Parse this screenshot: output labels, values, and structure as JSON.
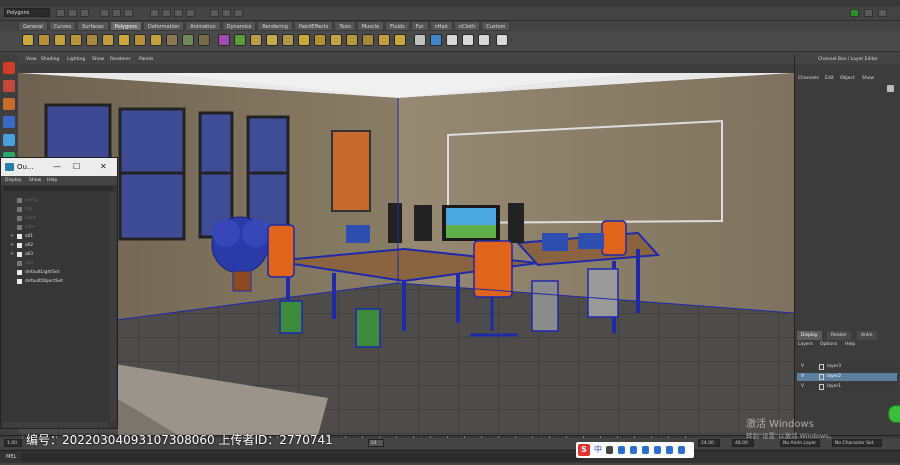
{
  "status_line": {
    "mode": "Polygons"
  },
  "shelf": {
    "tabs": [
      "General",
      "Curves",
      "Surfaces",
      "Polygons",
      "Deformation",
      "Animation",
      "Dynamics",
      "Rendering",
      "PaintEffects",
      "Toon",
      "Muscle",
      "Fluids",
      "Fur",
      "nHair",
      "nCloth",
      "Custom"
    ],
    "active_tab": "Polygons"
  },
  "panel_menu": [
    "View",
    "Shading",
    "Lighting",
    "Show",
    "Renderer",
    "Panels"
  ],
  "channel_box": {
    "title": "Channel Box / Layer Editor",
    "menu": [
      "Channels",
      "Edit",
      "Object",
      "Show"
    ]
  },
  "layer_editor": {
    "tabs": [
      "Display",
      "Render",
      "Anim"
    ],
    "active_tab": "Display",
    "menu": [
      "Layers",
      "Options",
      "Help"
    ],
    "layers": [
      {
        "visible": "V",
        "name": "layer3",
        "selected": false
      },
      {
        "visible": "V",
        "name": "layer2",
        "selected": true
      },
      {
        "visible": "V",
        "name": "layer1",
        "selected": false
      }
    ]
  },
  "outliner": {
    "title": "Ou...",
    "menu": [
      "Display",
      "Show",
      "Help"
    ],
    "items": [
      {
        "name": "persp",
        "dim": true,
        "expand": ""
      },
      {
        "name": "top",
        "dim": true,
        "expand": ""
      },
      {
        "name": "front",
        "dim": true,
        "expand": ""
      },
      {
        "name": "side",
        "dim": true,
        "expand": ""
      },
      {
        "name": "all1",
        "dim": false,
        "expand": "+"
      },
      {
        "name": "all2",
        "dim": false,
        "expand": "+"
      },
      {
        "name": "all3",
        "dim": false,
        "expand": "+"
      },
      {
        "name": "all4",
        "dim": true,
        "expand": ""
      },
      {
        "name": "defaultLightSet",
        "dim": false,
        "expand": ""
      },
      {
        "name": "defaultObjectSet",
        "dim": false,
        "expand": ""
      }
    ]
  },
  "range": {
    "start": "1.00",
    "current": "24",
    "end_a": "24.00",
    "end_b": "48.00",
    "anim_layer": "No Anim Layer",
    "char_set": "No Character Set"
  },
  "command_line": {
    "label": "MEL"
  },
  "watermark": {
    "text": "编号：20220304093107308060 上传者ID：2770741"
  },
  "ime": {
    "lang": "中"
  },
  "windows_activation": {
    "line1": "激活 Windows",
    "line2": "转到\"设置\"以激活 Windows。"
  },
  "colors": {
    "accent": "#5d7d9e",
    "wireframe": "#1e2aa8",
    "chair": "#e0641c"
  }
}
